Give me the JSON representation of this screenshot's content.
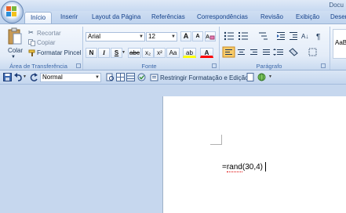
{
  "window": {
    "title": "Docu"
  },
  "tabs": [
    {
      "label": "Início",
      "active": true
    },
    {
      "label": "Inserir"
    },
    {
      "label": "Layout da Página"
    },
    {
      "label": "Referências"
    },
    {
      "label": "Correspondências"
    },
    {
      "label": "Revisão"
    },
    {
      "label": "Exibição"
    },
    {
      "label": "Desenv"
    }
  ],
  "clipboard": {
    "paste_label": "Colar",
    "cut_label": "Recortar",
    "copy_label": "Copiar",
    "format_painter_label": "Formatar Pincel",
    "group_title": "Área de Transferência"
  },
  "font": {
    "name": "Arial",
    "size": "12",
    "group_title": "Fonte",
    "bold": "N",
    "italic": "I",
    "underline": "S",
    "strike": "abc",
    "subscript": "x₂",
    "superscript": "x²",
    "change_case": "Aa",
    "highlight": "ab",
    "font_color": "A",
    "grow": "A",
    "shrink": "A"
  },
  "paragraph": {
    "group_title": "Parágrafo"
  },
  "styles": {
    "preview": "AaB"
  },
  "qat": {
    "style_value": "Normal",
    "restrict_label": "Restringir Formatação e Edição"
  },
  "document": {
    "text_prefix": "=",
    "text_squiggle": "rand",
    "text_suffix": "(30,4)"
  },
  "colors": {
    "ribbon_text": "#15428b",
    "highlight_yellow": "#ffff00",
    "font_red": "#ff0000",
    "accent_orange": "#f2a93b"
  }
}
